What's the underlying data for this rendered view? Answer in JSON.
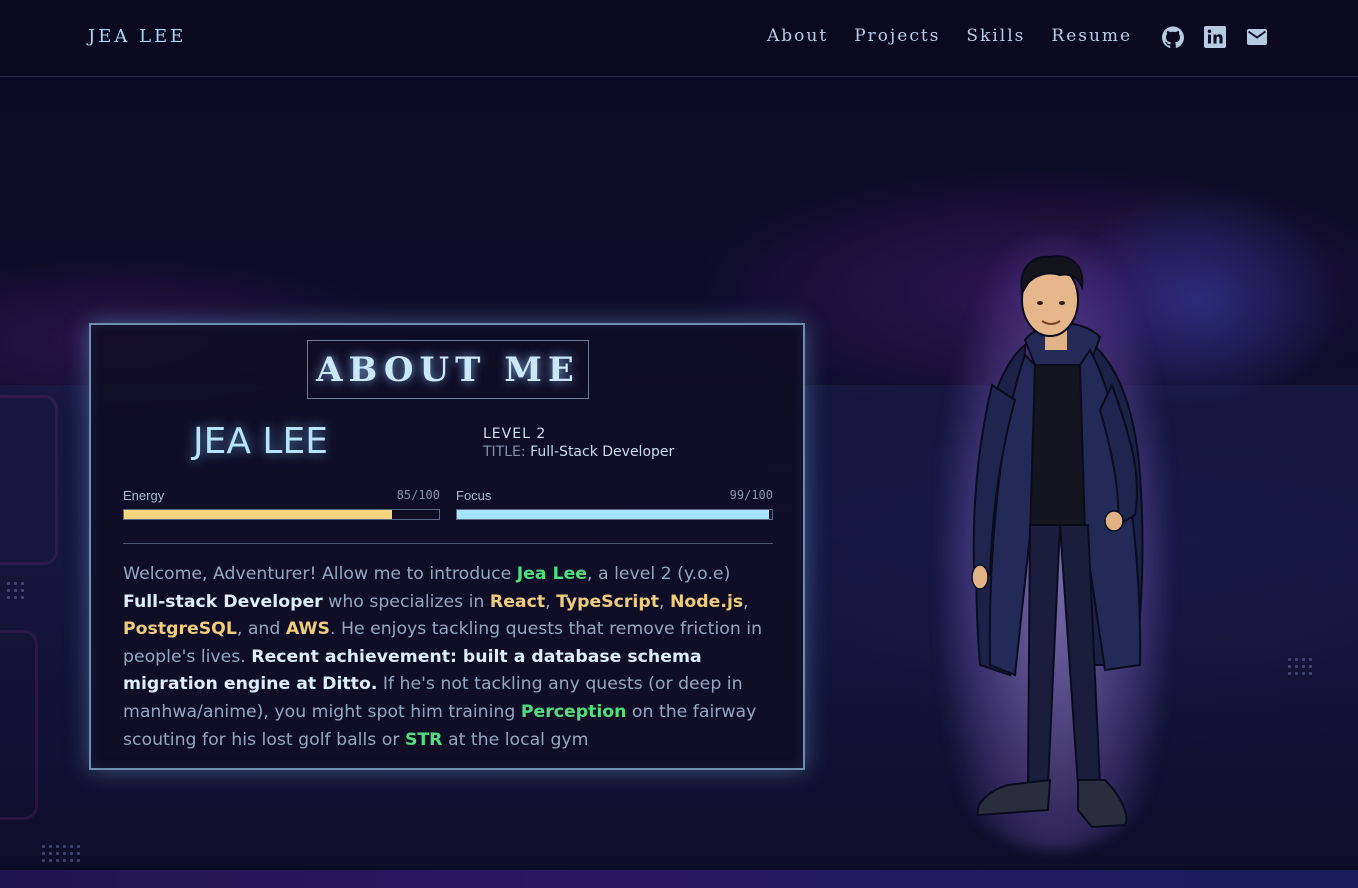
{
  "nav": {
    "brand": "JEA LEE",
    "links": [
      "About",
      "Projects",
      "Skills",
      "Resume"
    ],
    "icons": [
      "github-icon",
      "linkedin-icon",
      "mail-icon"
    ]
  },
  "about": {
    "heading": "ABOUT ME",
    "name": "JEA LEE",
    "level": "LEVEL 2",
    "title_label": "TITLE:",
    "title_value": "Full-Stack Developer",
    "stats": [
      {
        "label": "Energy",
        "display": "85/100",
        "value": 85,
        "max": 100,
        "color": "#f5d57e"
      },
      {
        "label": "Focus",
        "display": "99/100",
        "value": 99,
        "max": 100,
        "color": "#a5e2fb"
      }
    ],
    "bio": [
      {
        "t": "Welcome, Adventurer! Allow me to introduce ",
        "s": "n"
      },
      {
        "t": "Jea Lee",
        "s": "g"
      },
      {
        "t": ", a level 2 (y.o.e) ",
        "s": "n"
      },
      {
        "t": "Full-stack Developer",
        "s": "w"
      },
      {
        "t": " who specializes in ",
        "s": "n"
      },
      {
        "t": "React",
        "s": "y"
      },
      {
        "t": ", ",
        "s": "n"
      },
      {
        "t": "TypeScript",
        "s": "y"
      },
      {
        "t": ", ",
        "s": "n"
      },
      {
        "t": "Node.js",
        "s": "y"
      },
      {
        "t": ", ",
        "s": "n"
      },
      {
        "t": "PostgreSQL",
        "s": "y"
      },
      {
        "t": ", and ",
        "s": "n"
      },
      {
        "t": "AWS",
        "s": "y"
      },
      {
        "t": ". He enjoys tackling quests that remove friction in people's lives. ",
        "s": "n"
      },
      {
        "t": "Recent achievement: built a database schema migration engine at Ditto.",
        "s": "w"
      },
      {
        "t": " If he's not tackling any quests (or deep in manhwa/anime), you might spot him training ",
        "s": "n"
      },
      {
        "t": "Perception",
        "s": "g"
      },
      {
        "t": " on the fairway scouting for his lost golf balls or ",
        "s": "n"
      },
      {
        "t": "STR",
        "s": "g"
      },
      {
        "t": " at the local gym",
        "s": "n"
      }
    ]
  },
  "colors": {
    "accent_cyan": "#a5e2fb",
    "accent_gold": "#f5d57e",
    "accent_green": "#4de07f",
    "background": "#0d0b22"
  }
}
